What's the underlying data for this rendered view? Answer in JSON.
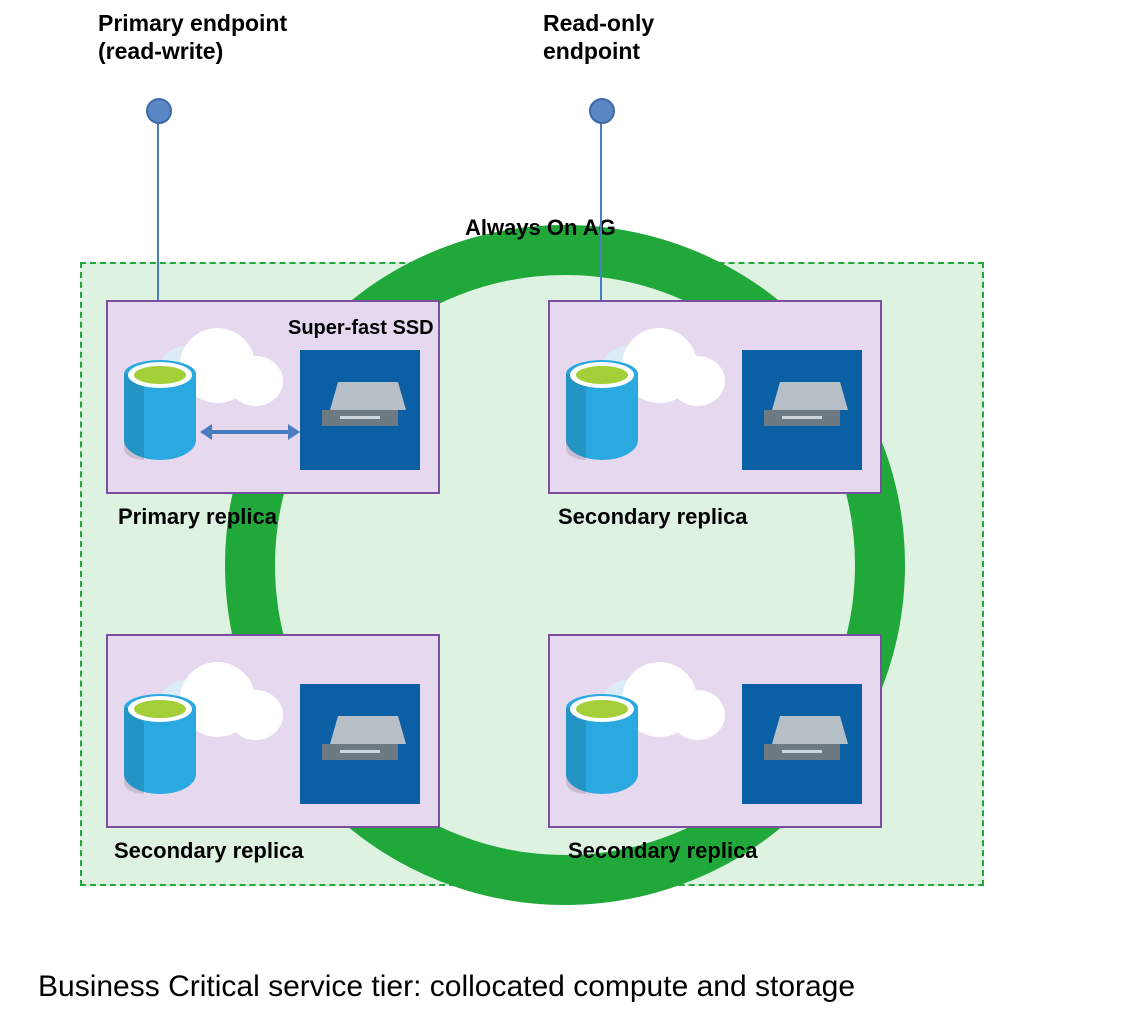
{
  "labels": {
    "primary_endpoint_line1": "Primary endpoint",
    "primary_endpoint_line2": "(read-write)",
    "readonly_endpoint_line1": "Read-only",
    "readonly_endpoint_line2": "endpoint",
    "always_on_ag": "Always On AG",
    "super_fast_ssd": "Super-fast SSD",
    "caption": "Business Critical service tier: collocated compute and storage"
  },
  "replicas": [
    {
      "role": "primary",
      "label": "Primary replica",
      "endpoint": "read-write"
    },
    {
      "role": "secondary",
      "label": "Secondary replica",
      "endpoint": "read-only"
    },
    {
      "role": "secondary",
      "label": "Secondary replica",
      "endpoint": null
    },
    {
      "role": "secondary",
      "label": "Secondary replica",
      "endpoint": null
    }
  ],
  "colors": {
    "ring_green": "#22a83a",
    "box_purple_border": "#7a4fa0",
    "box_purple_fill": "#e6d8ee",
    "azure_blue": "#0b5fa5",
    "db_blue": "#29a9e0",
    "connector_blue": "#4a7dc0"
  }
}
